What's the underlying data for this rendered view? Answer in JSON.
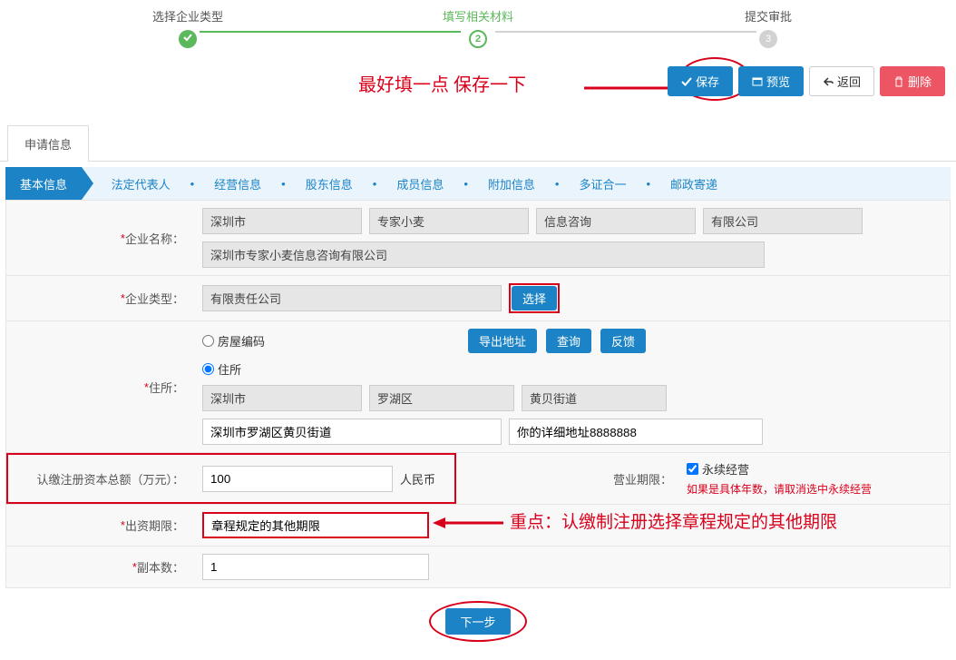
{
  "steps": {
    "s1": "选择企业类型",
    "s2": "填写相关材料",
    "s3": "提交审批"
  },
  "annot1": "最好填一点 保存一下",
  "toolbar": {
    "save": "保存",
    "preview": "预览",
    "back": "返回",
    "delete": "删除"
  },
  "mainTab": "申请信息",
  "nav": {
    "n1": "基本信息",
    "n2": "法定代表人",
    "n3": "经营信息",
    "n4": "股东信息",
    "n5": "成员信息",
    "n6": "附加信息",
    "n7": "多证合一",
    "n8": "邮政寄递"
  },
  "labels": {
    "company_name": "企业名称：",
    "company_type": "企业类型：",
    "address": "住所：",
    "reg_capital": "认缴注册资本总额（万元）：",
    "biz_term": "营业期限：",
    "contrib_term": "出资期限：",
    "copies": "副本数："
  },
  "company": {
    "city": "深圳市",
    "brand": "专家小麦",
    "industry": "信息咨询",
    "org": "有限公司",
    "full": "深圳市专家小麦信息咨询有限公司"
  },
  "company_type": "有限责任公司",
  "choose": "选择",
  "addr": {
    "house_code": "房屋编码",
    "residence": "住所",
    "export": "导出地址",
    "query": "查询",
    "feedback": "反馈",
    "city": "深圳市",
    "district": "罗湖区",
    "street": "黄贝街道",
    "road": "深圳市罗湖区黄贝街道",
    "detail": "你的详细地址8888888"
  },
  "capital": {
    "amount": "100",
    "currency": "人民币"
  },
  "biz": {
    "perpetual": "永续经营",
    "note": "如果是具体年数，请取消选中永续经营"
  },
  "contrib": "章程规定的其他期限",
  "copies": "1",
  "next": "下一步",
  "annot2": "重点：认缴制注册选择章程规定的其他期限"
}
